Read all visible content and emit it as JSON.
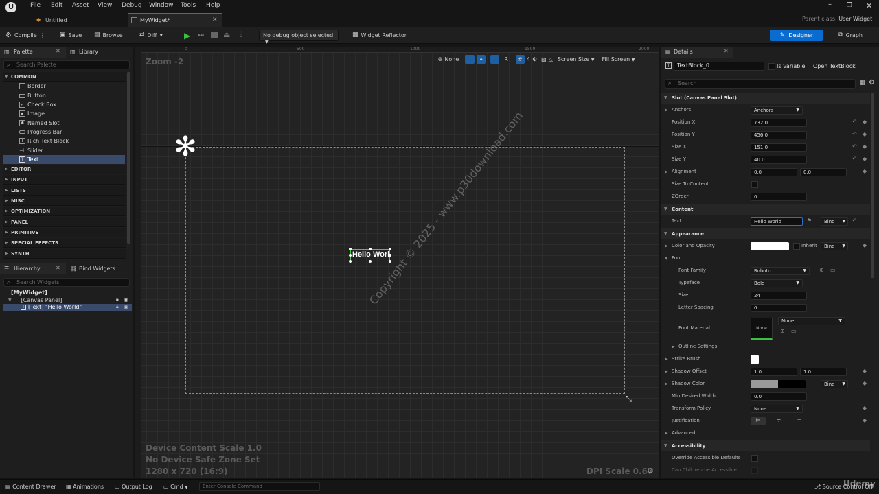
{
  "menu": [
    "File",
    "Edit",
    "Asset",
    "View",
    "Debug",
    "Window",
    "Tools",
    "Help"
  ],
  "tabs": [
    {
      "label": "Untitled"
    },
    {
      "label": "MyWidget*"
    }
  ],
  "parent_class": {
    "label": "Parent class:",
    "value": "User Widget"
  },
  "toolbar": {
    "compile": "Compile",
    "save": "Save",
    "browse": "Browse",
    "diff": "Diff",
    "debug_select": "No debug object selected",
    "widget_reflector": "Widget Reflector",
    "designer": "Designer",
    "graph": "Graph"
  },
  "palette": {
    "tab_label": "Palette",
    "library_tab": "Library",
    "search_placeholder": "Search Palette",
    "common_label": "COMMON",
    "items": [
      "Border",
      "Button",
      "Check Box",
      "Image",
      "Named Slot",
      "Progress Bar",
      "Rich Text Block",
      "Slider",
      "Text"
    ],
    "categories": [
      "EDITOR",
      "INPUT",
      "LISTS",
      "MISC",
      "OPTIMIZATION",
      "PANEL",
      "PRIMITIVE",
      "SPECIAL EFFECTS",
      "SYNTH"
    ]
  },
  "hierarchy": {
    "tab_label": "Hierarchy",
    "bind_tab": "Bind Widgets",
    "search_placeholder": "Search Widgets",
    "root": "[MyWidget]",
    "canvas": "[Canvas Panel]",
    "text_item": "[Text] \"Hello World\""
  },
  "viewport": {
    "zoom": "Zoom -2",
    "none": "None",
    "r": "R",
    "grid_val": "4",
    "screen_size": "Screen Size",
    "fill_screen": "Fill Screen",
    "ruler_top": [
      "0",
      "500",
      "1000",
      "1500",
      "2000"
    ],
    "widget_text": "Hello World",
    "watermark": "Copyright © 2025 - www.p30download.com",
    "device_scale": "Device Content Scale 1.0",
    "safe_zone": "No Device Safe Zone Set",
    "resolution": "1280 x 720 (16:9)",
    "dpi": "DPI Scale 0.67"
  },
  "details": {
    "tab_label": "Details",
    "widget_name": "TextBlock_0",
    "is_variable": "Is Variable",
    "open_link": "Open TextBlock",
    "search_placeholder": "Search",
    "slot_section": "Slot (Canvas Panel Slot)",
    "anchors_label": "Anchors",
    "anchors_value": "Anchors",
    "pos_x_label": "Position X",
    "pos_x": "732.0",
    "pos_y_label": "Position Y",
    "pos_y": "456.0",
    "size_x_label": "Size X",
    "size_x": "151.0",
    "size_y_label": "Size Y",
    "size_y": "40.0",
    "alignment_label": "Alignment",
    "align_x": "0.0",
    "align_y": "0.0",
    "size_to_content": "Size To Content",
    "zorder_label": "ZOrder",
    "zorder": "0",
    "content_section": "Content",
    "text_label": "Text",
    "text_value": "Hello World",
    "bind": "Bind",
    "appearance_section": "Appearance",
    "color_label": "Color and Opacity",
    "inherit": "Inherit",
    "font_label": "Font",
    "font_family_label": "Font Family",
    "font_family": "Roboto",
    "typeface_label": "Typeface",
    "typeface": "Bold",
    "size_label": "Size",
    "size": "24",
    "letter_spacing_label": "Letter Spacing",
    "letter_spacing": "0",
    "font_material_label": "Font Material",
    "font_material": "None",
    "font_material_thumb": "None",
    "outline_label": "Outline Settings",
    "strike_label": "Strike Brush",
    "shadow_offset_label": "Shadow Offset",
    "shadow_x": "1.0",
    "shadow_y": "1.0",
    "shadow_color_label": "Shadow Color",
    "min_width_label": "Min Desired Width",
    "min_width": "0.0",
    "transform_label": "Transform Policy",
    "transform": "None",
    "justification_label": "Justification",
    "advanced_label": "Advanced",
    "accessibility_section": "Accessibility",
    "override_label": "Override Accessible Defaults",
    "children_label": "Can Children be Accessible"
  },
  "bottom": {
    "content_drawer": "Content Drawer",
    "animations": "Animations",
    "output_log": "Output Log",
    "cmd": "Cmd",
    "console_placeholder": "Enter Console Command",
    "source_control": "Source Control Off",
    "udemy": "Udemy"
  }
}
